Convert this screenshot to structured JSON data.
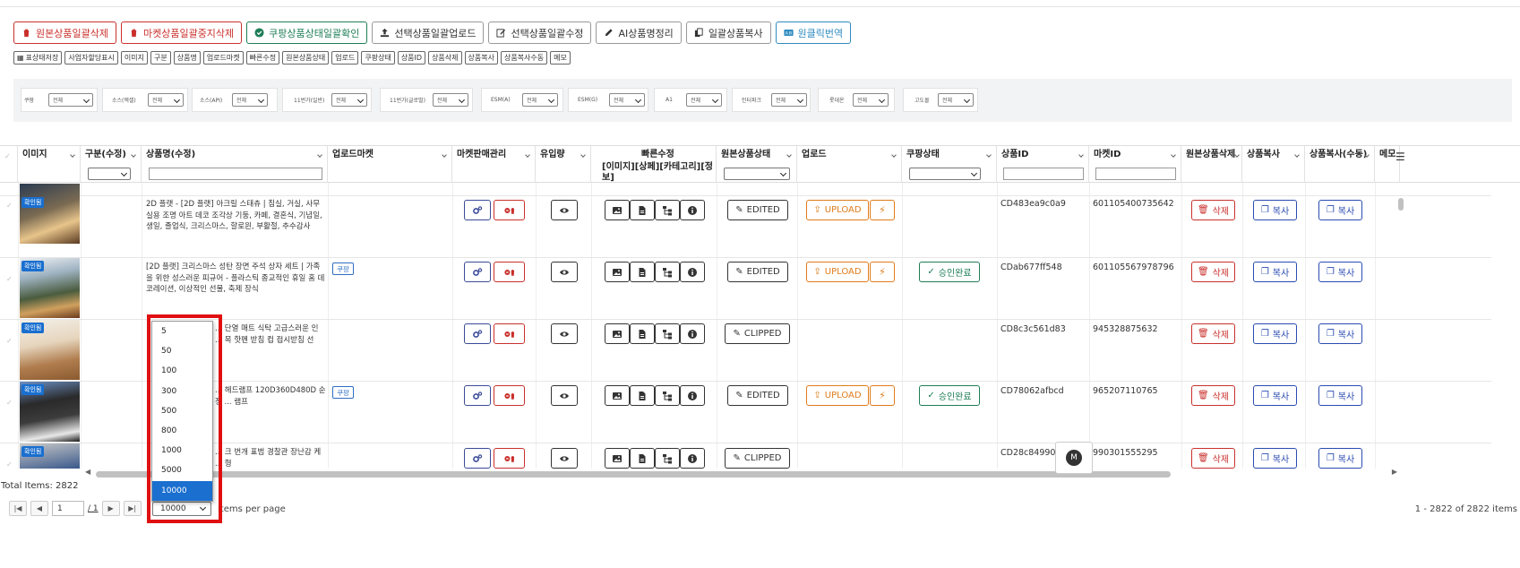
{
  "toolbar": {
    "btn1": "원본상품일괄삭제",
    "btn2": "마켓상품일괄중지삭제",
    "btn3": "쿠팡상품상태일괄확인",
    "btn4": "선택상품일괄업로드",
    "btn5": "선택상품일괄수정",
    "btn6": "AI상품명정리",
    "btn7": "일괄상품복사",
    "btn8": "원클릭번역"
  },
  "colbar": [
    "표상태저장",
    "사업자할당표시",
    "이미지",
    "구분",
    "상품명",
    "업로드마켓",
    "빠른수정",
    "원본상품상태",
    "업로드",
    "쿠팡상태",
    "상품ID",
    "상품삭제",
    "상품복사",
    "상품복사수동",
    "메모"
  ],
  "filters": [
    {
      "label": "쿠팡",
      "value": "전체"
    },
    {
      "label": "소스(엑셀)",
      "value": "전체"
    },
    {
      "label": "소스(API)",
      "value": "전체"
    },
    {
      "label": "11번가(일반)",
      "value": "전체"
    },
    {
      "label": "11번가(글로벌)",
      "value": "전체"
    },
    {
      "label": "ESM(A)",
      "value": "전체"
    },
    {
      "label": "ESM(G)",
      "value": "전체"
    },
    {
      "label": "A1",
      "value": "전체"
    },
    {
      "label": "인터파크",
      "value": "전체"
    },
    {
      "label": "롯데온",
      "value": "전체"
    },
    {
      "label": "고도몰",
      "value": "전체"
    }
  ],
  "columns": {
    "image": "이미지",
    "category": "구분(수정)",
    "name": "상품명(수정)",
    "market": "업로드마켓",
    "sales": "마켓판매관리",
    "inflow": "유입량",
    "quick1": "빠른수정",
    "quick2": "[이미지][상페][카테고리][정보]",
    "origin": "원본상품상태",
    "upload": "업로드",
    "coupang": "쿠팡상태",
    "pid": "상품ID",
    "mid": "마켓ID",
    "del": "원본상품삭제",
    "copy": "상품복사",
    "copym": "상품복사(수동)",
    "memo": "메모"
  },
  "badge": "확인됨",
  "rows": [
    {
      "name": "2D 플랫 - [2D 플랫] 아크릴 스태츄 | 침실, 거실, 사무실용 조명 아트 데코 조각상 기둥, 카페, 결혼식, 기념일, 생일, 졸업식, 크리스마스, 할로윈, 부활절, 추수감사",
      "market": "",
      "status": "EDITED",
      "upload": "UPLOAD",
      "coupang": "",
      "pid": "CD483ea9c0a9",
      "mid": "601105400735642"
    },
    {
      "name": "[2D 플랫] 크리스마스 성탄 장면 주석 상자 세트 | 가족을 위한 성스러운 피규어 - 플라스틱 종교적인 휴일 홈 데코레이션, 이상적인 선물, 축제 장식",
      "market": "쿠팡",
      "status": "EDITED",
      "upload": "UPLOAD",
      "coupang": "승인완료",
      "pid": "CDab677ff548",
      "mid": "601105567978796"
    },
    {
      "name": "... 단열 매트 식탁 고급스러운 인 ... 목 핫펜 받침 컵 접시받침 선",
      "market": "",
      "status": "CLIPPED",
      "upload": "",
      "coupang": "",
      "pid": "CD8c3c561d83",
      "mid": "945328875632"
    },
    {
      "name": "... 헤드램프 120D360D480D 순정 ... 램프",
      "market": "쿠팡",
      "status": "EDITED",
      "upload": "UPLOAD",
      "coupang": "승인완료",
      "pid": "CD78062afbcd",
      "mid": "965207110765"
    },
    {
      "name": "... 크 번개 표범 경찰관 장난감 케 ... 형",
      "market": "",
      "status": "CLIPPED",
      "upload": "",
      "coupang": "",
      "pid": "CD28c8499097",
      "mid": "990301555295"
    }
  ],
  "actions": {
    "delete": "삭제",
    "copy": "복사"
  },
  "footer": {
    "total": "Total Items: 2822",
    "page": "1",
    "of_pages": "/ 1",
    "per_page": "10000",
    "per_page_label": "items per page",
    "range": "1 - 2822 of 2822 items"
  },
  "page_size_options": [
    "5",
    "50",
    "100",
    "300",
    "500",
    "800",
    "1000",
    "5000",
    "10000"
  ],
  "colors": {
    "primary": "#1a6fcf",
    "danger": "#c9302c",
    "success": "#1e7e57",
    "warning": "#e07b1a",
    "highlight": "#e01010"
  }
}
